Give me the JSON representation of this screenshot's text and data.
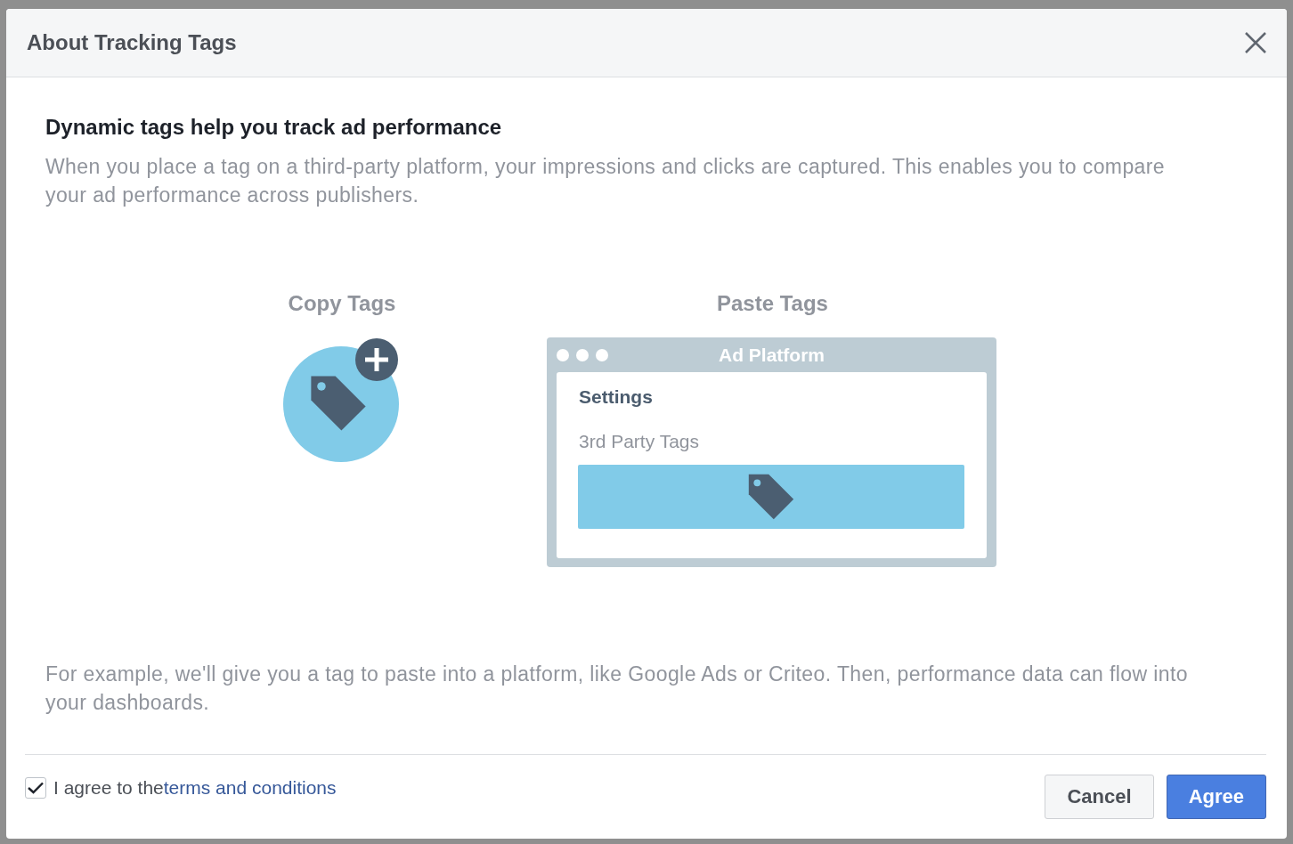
{
  "dialog": {
    "title": "About Tracking Tags"
  },
  "heading": "Dynamic tags help you track ad performance",
  "intro": "When you place a tag on a third-party platform, your impressions and clicks are captured. This enables you to compare your ad performance across publishers.",
  "illustration": {
    "copy_label": "Copy Tags",
    "paste_label": "Paste Tags",
    "window_title": "Ad Platform",
    "settings_label": "Settings",
    "field_label": "3rd Party Tags"
  },
  "example": "For example, we'll give you a tag to paste into a platform, like Google Ads or Criteo. Then, performance data can flow into your dashboards.",
  "agreement": {
    "checked": true,
    "text": "I agree to the",
    "link": "terms and conditions"
  },
  "buttons": [
    {
      "label": "Cancel",
      "kind": "secondary"
    },
    {
      "label": "Agree",
      "kind": "primary"
    }
  ]
}
